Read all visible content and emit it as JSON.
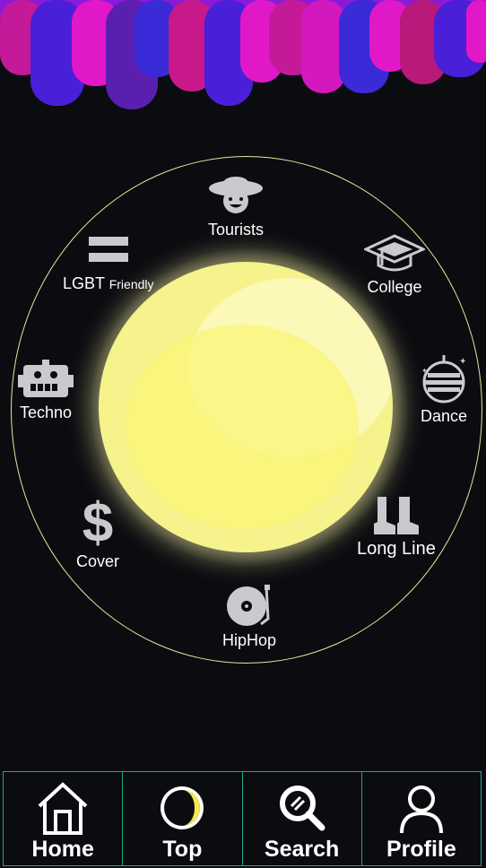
{
  "categories": {
    "tourists": {
      "label": "Tourists",
      "icon": "tourist-face-icon"
    },
    "college": {
      "label": "College",
      "icon": "graduation-cap-icon"
    },
    "dance": {
      "label": "Dance",
      "icon": "disco-ball-icon"
    },
    "long_line": {
      "label": "Long Line",
      "icon": "boots-icon"
    },
    "hiphop": {
      "label": "HipHop",
      "icon": "turntable-icon"
    },
    "cover": {
      "label": "Cover",
      "icon": "dollar-icon"
    },
    "techno": {
      "label": "Techno",
      "icon": "robot-icon"
    },
    "lgbt": {
      "label": "LGBT",
      "label_small": "Friendly",
      "icon": "equals-icon"
    }
  },
  "nav": {
    "home": {
      "label": "Home",
      "icon": "house-icon"
    },
    "top": {
      "label": "Top",
      "icon": "moon-icon"
    },
    "search": {
      "label": "Search",
      "icon": "magnifier-icon"
    },
    "profile": {
      "label": "Profile",
      "icon": "person-icon"
    }
  },
  "colors": {
    "background": "#0b0c10",
    "moon": "#f6f28c",
    "ring": "#e9e59a",
    "nav_border": "#1aa88d",
    "icon_gray": "#c9c9ce",
    "banner_magenta": "#e018c8",
    "banner_violet": "#5a1fe0"
  }
}
